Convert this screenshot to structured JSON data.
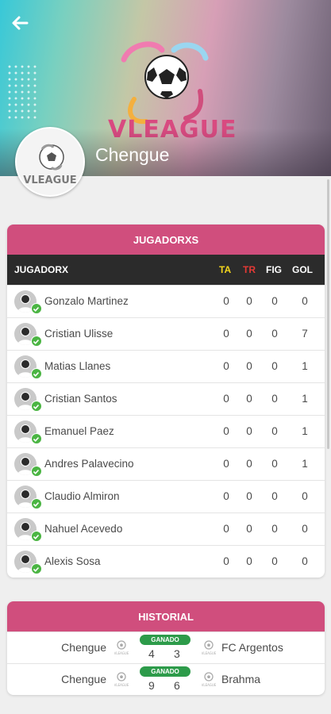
{
  "header": {
    "back_icon": "arrow-left-icon",
    "league_logo_text": "VLEAGUE",
    "team_logo_text": "VLEAGUE",
    "team_name": "Chengue"
  },
  "players_card": {
    "title": "JUGADORXS",
    "columns": {
      "player": "JUGADORX",
      "ta": "TA",
      "tr": "TR",
      "fig": "FIG",
      "gol": "GOL"
    },
    "column_colors": {
      "ta": "#f2d51c",
      "tr": "#e53935"
    },
    "rows": [
      {
        "name": "Gonzalo Martinez",
        "ta": "0",
        "tr": "0",
        "fig": "0",
        "gol": "0"
      },
      {
        "name": "Cristian Ulisse",
        "ta": "0",
        "tr": "0",
        "fig": "0",
        "gol": "7"
      },
      {
        "name": "Matias Llanes",
        "ta": "0",
        "tr": "0",
        "fig": "0",
        "gol": "1"
      },
      {
        "name": "Cristian Santos",
        "ta": "0",
        "tr": "0",
        "fig": "0",
        "gol": "1"
      },
      {
        "name": "Emanuel Paez",
        "ta": "0",
        "tr": "0",
        "fig": "0",
        "gol": "1"
      },
      {
        "name": "Andres Palavecino",
        "ta": "0",
        "tr": "0",
        "fig": "0",
        "gol": "1"
      },
      {
        "name": "Claudio Almiron",
        "ta": "0",
        "tr": "0",
        "fig": "0",
        "gol": "0"
      },
      {
        "name": "Nahuel Acevedo",
        "ta": "0",
        "tr": "0",
        "fig": "0",
        "gol": "0"
      },
      {
        "name": "Alexis Sosa",
        "ta": "0",
        "tr": "0",
        "fig": "0",
        "gol": "0"
      }
    ]
  },
  "history_card": {
    "title": "HISTORIAL",
    "matches": [
      {
        "home": "Chengue",
        "result": "GANADO",
        "home_score": "4",
        "away_score": "3",
        "away": "FC Argentos"
      },
      {
        "home": "Chengue",
        "result": "GANADO",
        "home_score": "9",
        "away_score": "6",
        "away": "Brahma"
      }
    ]
  },
  "colors": {
    "accent": "#d04e7d",
    "header_dark": "#2b2b2b",
    "win_badge": "#2d9b4a",
    "check": "#4bb543"
  }
}
